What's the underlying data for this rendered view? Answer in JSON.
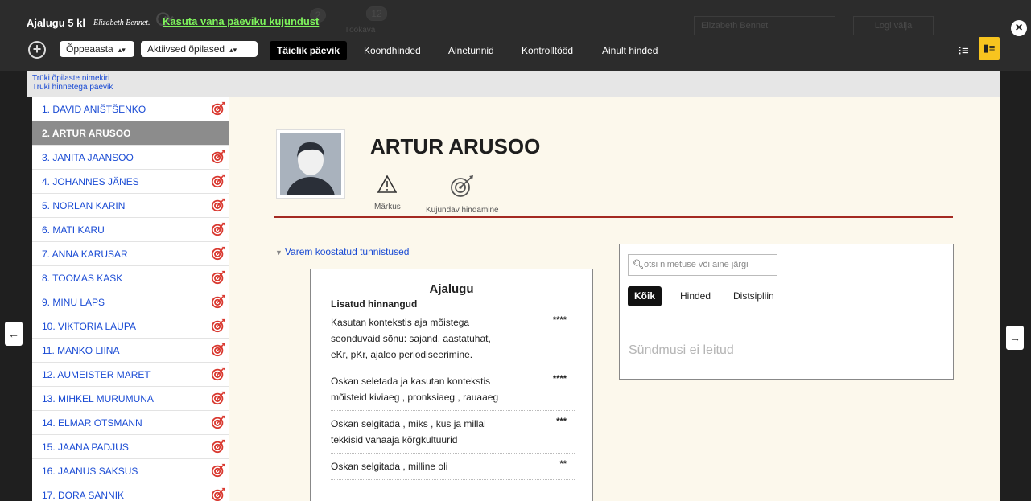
{
  "header": {
    "course_title": "Ajalugu 5 kl",
    "teacher": "Elizabeth Bennet.",
    "old_view_link": "Kasuta vana päeviku kujundust",
    "user_name": "Elizabeth Bennet",
    "logout": "Logi välja",
    "behind_badges": [
      "2",
      "12"
    ],
    "behind_label": "Töökava"
  },
  "toolbar": {
    "year_select": "Õppeaasta",
    "students_select": "Aktiivsed õpilased",
    "tabs": [
      "Täielik päevik",
      "Koondhinded",
      "Ainetunnid",
      "Kontrolltööd",
      "Ainult hinded"
    ]
  },
  "print_links": [
    "Trüki õpilaste nimekiri",
    "Trüki hinnetega päevik"
  ],
  "students": [
    "1. DAVID ANIŠTŠENKO",
    "2. ARTUR ARUSOO",
    "3. JANITA JAANSOO",
    "4. JOHANNES JÄNES",
    "5. NORLAN KARIN",
    "6. MATI KARU",
    "7. ANNA KARUSAR",
    "8. TOOMAS KASK",
    "9. MINU LAPS",
    "10. VIKTORIA LAUPA",
    "11. MANKO LIINA",
    "12. AUMEISTER MARET",
    "13. MIHKEL MURUMUNA",
    "14. ELMAR OTSMANN",
    "15. JAANA PADJUS",
    "16. JAANUS SAKSUS",
    "17. DORA SANNIK"
  ],
  "profile": {
    "name": "ARTUR ARUSOO",
    "actions": [
      "Märkus",
      "Kujundav hindamine"
    ]
  },
  "previous_link": "Varem koostatud tunnistused",
  "card": {
    "title": "Ajalugu",
    "subtitle": "Lisatud hinnangud",
    "items": [
      {
        "text": "Kasutan kontekstis aja mõistega seonduvaid sõnu: sajand, aastatuhat, eKr, pKr, ajaloo periodiseerimine.",
        "stars": "****"
      },
      {
        "text": "Oskan seletada ja kasutan kontekstis mõisteid kiviaeg , pronksiaeg , rauaaeg",
        "stars": "****"
      },
      {
        "text": "Oskan selgitada , miks , kus ja millal tekkisid vanaaja kõrgkultuurid",
        "stars": "***"
      },
      {
        "text": "Oskan selgitada , milline oli",
        "stars": "**"
      }
    ]
  },
  "events": {
    "search_placeholder": "otsi nimetuse või aine järgi",
    "filters": [
      "Kõik",
      "Hinded",
      "Distsipliin"
    ],
    "empty_text": "Sündmusi ei leitud"
  },
  "colors": {
    "accent_green": "#7ef35c",
    "link_blue": "#1a4bd4",
    "divider_red": "#a42a22",
    "badge_yellow": "#f7c41f"
  }
}
